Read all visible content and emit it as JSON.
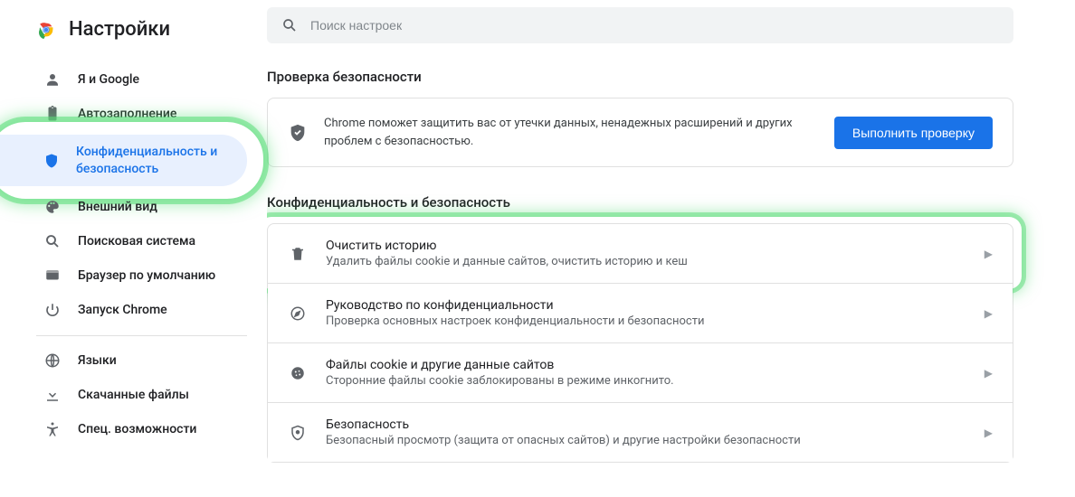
{
  "header": {
    "title": "Настройки"
  },
  "search": {
    "placeholder": "Поиск настроек"
  },
  "sidebar": {
    "items": [
      {
        "label": "Я и Google"
      },
      {
        "label": "Автозаполнение"
      },
      {
        "label": "Конфиденциальность и безопасность"
      },
      {
        "label": "Внешний вид"
      },
      {
        "label": "Поисковая система"
      },
      {
        "label": "Браузер по умолчанию"
      },
      {
        "label": "Запуск Chrome"
      },
      {
        "label": "Языки"
      },
      {
        "label": "Скачанные файлы"
      },
      {
        "label": "Спец. возможности"
      }
    ]
  },
  "main": {
    "section1_title": "Проверка безопасности",
    "safety_text": "Chrome поможет защитить вас от утечки данных, ненадежных расширений и других проблем с безопасностью.",
    "safety_button": "Выполнить проверку",
    "section2_title": "Конфиденциальность и безопасность",
    "rows": [
      {
        "t1": "Очистить историю",
        "t2": "Удалить файлы cookie и данные сайтов, очистить историю и кеш"
      },
      {
        "t1": "Руководство по конфиденциальности",
        "t2": "Проверка основных настроек конфиденциальности и безопасности"
      },
      {
        "t1": "Файлы cookie и другие данные сайтов",
        "t2": "Сторонние файлы cookie заблокированы в режиме инкогнито."
      },
      {
        "t1": "Безопасность",
        "t2": "Безопасный просмотр (защита от опасных сайтов) и другие настройки безопасности"
      }
    ]
  }
}
